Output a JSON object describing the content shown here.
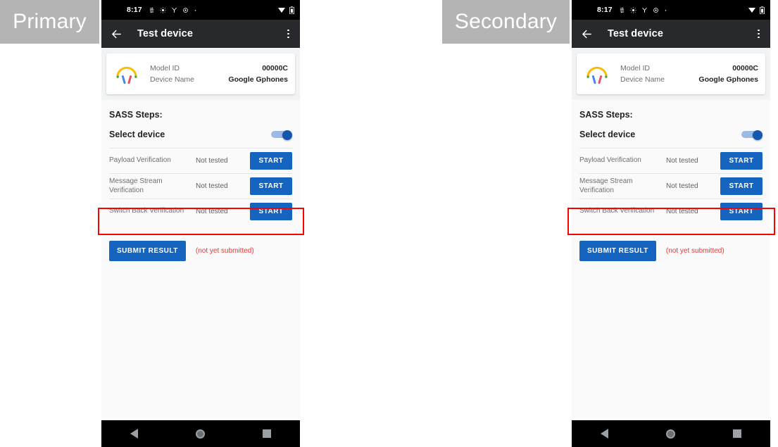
{
  "annotations": {
    "primary_label": "Primary",
    "secondary_label": "Secondary",
    "highlight_color": "#ff0000",
    "badge_bg": "#b4b4b4"
  },
  "phone": {
    "status_bar": {
      "clock": "8:17",
      "left_icons": [
        "sync-icon",
        "brightness-icon",
        "vpn-icon",
        "settings-icon",
        "dot-icon"
      ],
      "right_icons": [
        "wifi-icon",
        "battery-icon"
      ],
      "background": "#000000"
    },
    "app_bar": {
      "back_icon": "back-arrow-icon",
      "title": "Test device",
      "overflow_icon": "overflow-menu-icon",
      "background": "#27292c"
    },
    "device_card": {
      "icon": "headphones-icon",
      "rows": [
        {
          "label": "Model ID",
          "value": "00000C"
        },
        {
          "label": "Device Name",
          "value": "Google Gphones"
        }
      ]
    },
    "steps_section": {
      "title": "SASS Steps:",
      "select_device": {
        "label": "Select device",
        "toggle_state": "on",
        "toggle_color": "#1557b0"
      },
      "rows": [
        {
          "name": "Payload Verification",
          "status": "Not tested",
          "action": "START"
        },
        {
          "name": "Message Stream Verification",
          "status": "Not tested",
          "action": "START"
        },
        {
          "name": "Switch Back Verification",
          "status": "Not tested",
          "action": "START"
        }
      ],
      "highlighted_row_index": 2
    },
    "submit": {
      "button_label": "SUBMIT RESULT",
      "note": "(not yet submitted)",
      "button_color": "#1565c0",
      "note_color": "#e53935"
    },
    "nav_bar": {
      "back": "nav-back-icon",
      "home": "nav-home-icon",
      "recents": "nav-recents-icon"
    }
  }
}
